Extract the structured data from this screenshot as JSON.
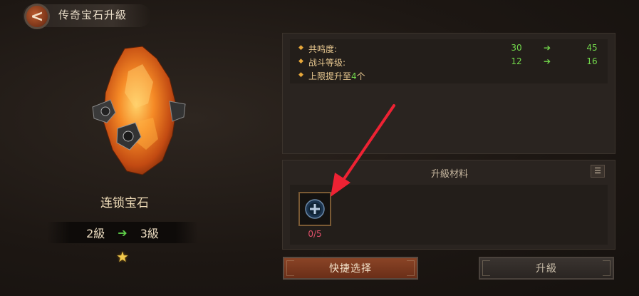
{
  "header": {
    "title": "传奇宝石升級",
    "back_label": "<"
  },
  "gem": {
    "name": "连锁宝石"
  },
  "level": {
    "from": "2級",
    "to": "3級",
    "arrow": "➔"
  },
  "stats": {
    "rows": [
      {
        "label": "共鸣度:",
        "from": "30",
        "to": "45",
        "arrow": "➔"
      },
      {
        "label": "战斗等级:",
        "from": "12",
        "to": "16",
        "arrow": "➔"
      }
    ],
    "limit": {
      "prefix": "上限提升至",
      "number": "4",
      "suffix": "个"
    }
  },
  "materials": {
    "title": "升級材料",
    "count": "0/5",
    "info_icon": "list-info-icon"
  },
  "buttons": {
    "quick_select": "快捷选择",
    "upgrade": "升級"
  },
  "colors": {
    "accent": "#e8a83a",
    "green": "#73d94c",
    "red_count": "#e0506a",
    "annotation": "#ee2233"
  }
}
